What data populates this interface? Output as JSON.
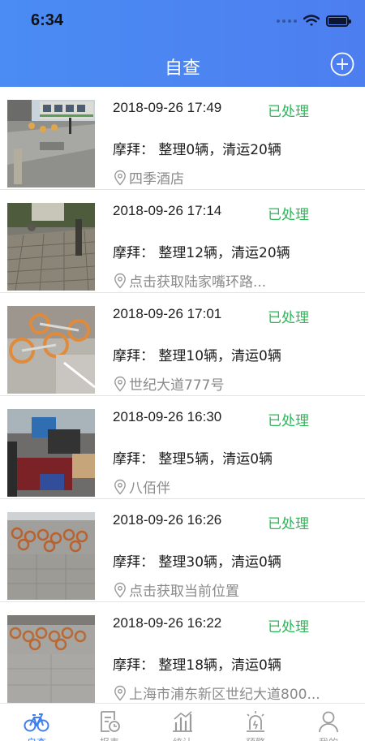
{
  "status_bar": {
    "time": "6:34"
  },
  "header": {
    "title": "自查",
    "add_icon": "plus-circle-icon"
  },
  "colors": {
    "header": "#4a86f2",
    "status_done": "#2ab857",
    "tab_active": "#3f7ff0"
  },
  "records": [
    {
      "time": "2018-09-26 17:49",
      "status": "已处理",
      "summary": "摩拜：  整理0辆，清运20辆",
      "location": "四季酒店"
    },
    {
      "time": "2018-09-26 17:14",
      "status": "已处理",
      "summary": "摩拜：  整理12辆，清运20辆",
      "location": "点击获取陆家嘴环路..."
    },
    {
      "time": "2018-09-26 17:01",
      "status": "已处理",
      "summary": "摩拜：  整理10辆，清运0辆",
      "location": "世纪大道777号"
    },
    {
      "time": "2018-09-26 16:30",
      "status": "已处理",
      "summary": "摩拜：  整理5辆，清运0辆",
      "location": "八佰伴"
    },
    {
      "time": "2018-09-26 16:26",
      "status": "已处理",
      "summary": "摩拜：  整理30辆，清运0辆",
      "location": "点击获取当前位置"
    },
    {
      "time": "2018-09-26 16:22",
      "status": "已处理",
      "summary": "摩拜：  整理18辆，清运0辆",
      "location": "上海市浦东新区世纪大道800..."
    }
  ],
  "tabs": [
    {
      "label": "自查",
      "icon": "bike-icon",
      "active": true
    },
    {
      "label": "报表",
      "icon": "report-icon",
      "active": false
    },
    {
      "label": "统计",
      "icon": "chart-icon",
      "active": false
    },
    {
      "label": "预警",
      "icon": "alarm-icon",
      "active": false
    },
    {
      "label": "我的",
      "icon": "user-icon",
      "active": false
    }
  ]
}
